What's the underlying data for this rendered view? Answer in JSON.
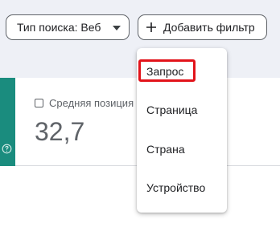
{
  "filters": {
    "search_type_label": "Тип поиска: Веб",
    "add_filter_label": "Добавить фильтр"
  },
  "metric": {
    "label": "Средняя позиция",
    "value": "32,7"
  },
  "menu": {
    "items": [
      {
        "label": "Запрос",
        "highlighted": true
      },
      {
        "label": "Страница"
      },
      {
        "label": "Страна"
      },
      {
        "label": "Устройство"
      }
    ]
  },
  "colors": {
    "accent_green": "#1a8c7e",
    "highlight_red": "#e2131a",
    "topbar_bg": "#eef0f6"
  },
  "icons": [
    "caret-down-icon",
    "plus-icon",
    "help-icon",
    "checkbox-icon"
  ]
}
